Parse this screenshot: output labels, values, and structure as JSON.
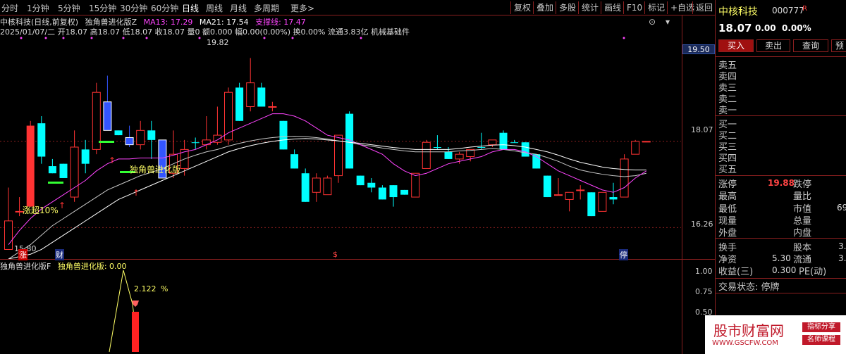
{
  "top_tabs": [
    "分时",
    "1分钟",
    "5分钟",
    "15分钟",
    "30分钟",
    "60分钟",
    "日线",
    "周线",
    "月线",
    "多周期",
    "更多>"
  ],
  "top_buttons": [
    "复权",
    "叠加",
    "多股",
    "统计",
    "画线",
    "F10",
    "标记",
    "+自选",
    "返回"
  ],
  "info_line1": {
    "title": "中核科技(日线,前复权)",
    "indicator": "独角兽进化版Z",
    "ma13": "MA13: 17.29",
    "ma21": "MA21: 17.54",
    "line": "支撑线: 17.47"
  },
  "info_line2": "2025/01/07/二 开18.07 高18.07 低18.07 收18.07 量0 额0.000 幅0.00(0.00%) 换0.00% 流通3.83亿 机械基础件",
  "price_axis": [
    "19.50",
    "18.07",
    "16.26"
  ],
  "annotations": {
    "high": "19.82",
    "low": "15.80",
    "zhangchao": "涨超10%",
    "unicorn": "独角兽进化版"
  },
  "markers": [
    "涨",
    "财",
    "$",
    "停"
  ],
  "sub_info": {
    "title": "独角兽进化版F",
    "value": "独角兽进化版: 0.00",
    "pct": "2.122",
    "pct_unit": "%"
  },
  "sub_axis": [
    "1.00",
    "0.75",
    "0.50"
  ],
  "panel": {
    "name": "中核科技",
    "code": "000777",
    "r": "R",
    "price": "18.07",
    "chg": "0.00",
    "pct": "0.00%",
    "buy": "买入",
    "sell": "卖出",
    "query": "查询",
    "pre": "预",
    "asks": [
      "卖五",
      "卖四",
      "卖三",
      "卖二",
      "卖一"
    ],
    "bids": [
      "买一",
      "买二",
      "买三",
      "买四",
      "买五"
    ],
    "limit_up_label": "涨停",
    "limit_up": "19.88",
    "limit_down_label": "跌停",
    "rows_left": [
      "最高",
      "最低",
      "现量",
      "外盘"
    ],
    "rows_right": [
      "量比",
      "市值",
      "总量",
      "内盘"
    ],
    "mktcap_partial": "69",
    "turnover_label": "换手",
    "equity_label": "股本",
    "equity_val": "3.",
    "nav_label": "净资",
    "nav": "5.30",
    "float_label": "流通",
    "float_val": "3.",
    "eps_label": "收益(三)",
    "eps": "0.300",
    "pe_label": "PE(动)",
    "status": "交易状态: 停牌"
  },
  "watermark": {
    "title": "股市财富网",
    "url": "WWW.GSCFW.COM",
    "tag1": "指标分享",
    "tag2": "名师课程"
  },
  "colors": {
    "up": "#ff3333",
    "down": "#00ffff",
    "bg": "#000000",
    "grid": "#8a1f1f",
    "ma13": "#ff44ff",
    "ma21": "#ffffff",
    "support": "#ff44ff"
  },
  "chart_data": {
    "type": "candlestick",
    "ylim": [
      15.6,
      20.3
    ],
    "candles": [
      {
        "o": 15.8,
        "h": 17.1,
        "l": 15.8,
        "c": 16.4,
        "up": true
      },
      {
        "o": 16.6,
        "h": 16.9,
        "l": 16.5,
        "c": 16.6,
        "up": true
      },
      {
        "o": 16.7,
        "h": 18.5,
        "l": 16.7,
        "c": 18.4,
        "up": true,
        "solid": true
      },
      {
        "o": 18.45,
        "h": 18.6,
        "l": 17.6,
        "c": 17.75,
        "up": false
      },
      {
        "o": 17.55,
        "h": 17.7,
        "l": 17.4,
        "c": 17.4,
        "up": false
      },
      {
        "o": 17.3,
        "h": 17.6,
        "l": 17.3,
        "c": 17.6,
        "up": false
      },
      {
        "o": 16.9,
        "h": 18.3,
        "l": 16.8,
        "c": 17.95,
        "up": true
      },
      {
        "o": 17.9,
        "h": 18.1,
        "l": 17.4,
        "c": 17.6,
        "up": false
      },
      {
        "o": 17.9,
        "h": 19.3,
        "l": 17.8,
        "c": 19.1,
        "up": true
      },
      {
        "o": 18.9,
        "h": 19.45,
        "l": 18.3,
        "c": 18.3,
        "up": false,
        "blue": true
      },
      {
        "o": 18.3,
        "h": 18.3,
        "l": 18.2,
        "c": 18.2,
        "up": false
      },
      {
        "o": 18.15,
        "h": 18.4,
        "l": 17.95,
        "c": 18.0,
        "up": false,
        "blue": true
      },
      {
        "o": 18.0,
        "h": 18.5,
        "l": 17.9,
        "c": 18.3,
        "up": true
      },
      {
        "o": 18.3,
        "h": 18.5,
        "l": 17.7,
        "c": 18.1,
        "up": false
      },
      {
        "o": 18.1,
        "h": 18.1,
        "l": 17.3,
        "c": 17.3,
        "up": false,
        "blue": true
      },
      {
        "o": 17.4,
        "h": 18.3,
        "l": 17.3,
        "c": 17.8,
        "up": true
      },
      {
        "o": 17.5,
        "h": 18.1,
        "l": 17.35,
        "c": 17.9,
        "up": true
      },
      {
        "o": 18.05,
        "h": 18.15,
        "l": 17.9,
        "c": 18.05,
        "up": false
      },
      {
        "o": 18.0,
        "h": 18.6,
        "l": 17.9,
        "c": 18.1,
        "up": true
      },
      {
        "o": 18.2,
        "h": 18.8,
        "l": 18.0,
        "c": 18.05,
        "up": true
      },
      {
        "o": 18.1,
        "h": 19.2,
        "l": 18.0,
        "c": 19.1,
        "up": true
      },
      {
        "o": 19.2,
        "h": 19.3,
        "l": 18.5,
        "c": 18.5,
        "up": false
      },
      {
        "o": 18.8,
        "h": 19.82,
        "l": 18.7,
        "c": 19.3,
        "up": true
      },
      {
        "o": 19.2,
        "h": 19.3,
        "l": 18.8,
        "c": 18.8,
        "up": false
      },
      {
        "o": 18.8,
        "h": 18.9,
        "l": 18.7,
        "c": 18.8,
        "up": true
      },
      {
        "o": 18.5,
        "h": 18.5,
        "l": 17.9,
        "c": 17.9,
        "up": false
      },
      {
        "o": 17.8,
        "h": 17.9,
        "l": 17.5,
        "c": 17.5,
        "up": false
      },
      {
        "o": 17.4,
        "h": 17.5,
        "l": 16.8,
        "c": 16.8,
        "up": false
      },
      {
        "o": 17.0,
        "h": 17.4,
        "l": 16.8,
        "c": 17.3,
        "up": true
      },
      {
        "o": 17.3,
        "h": 17.35,
        "l": 16.95,
        "c": 16.95,
        "up": true
      },
      {
        "o": 17.35,
        "h": 18.2,
        "l": 17.2,
        "c": 18.2,
        "up": true
      },
      {
        "o": 18.65,
        "h": 18.7,
        "l": 17.5,
        "c": 17.5,
        "up": false
      },
      {
        "o": 17.35,
        "h": 17.35,
        "l": 17.15,
        "c": 17.15,
        "up": false
      },
      {
        "o": 17.2,
        "h": 17.3,
        "l": 17.0,
        "c": 17.1,
        "up": false
      },
      {
        "o": 17.1,
        "h": 17.15,
        "l": 16.85,
        "c": 16.85,
        "up": false
      },
      {
        "o": 17.15,
        "h": 17.15,
        "l": 16.7,
        "c": 16.9,
        "up": false
      },
      {
        "o": 17.05,
        "h": 17.05,
        "l": 16.95,
        "c": 16.95,
        "up": false
      },
      {
        "o": 16.9,
        "h": 17.4,
        "l": 16.9,
        "c": 17.4,
        "up": true
      },
      {
        "o": 17.5,
        "h": 18.1,
        "l": 17.5,
        "c": 18.05,
        "up": true
      },
      {
        "o": 17.95,
        "h": 18.2,
        "l": 17.9,
        "c": 17.95,
        "up": false
      },
      {
        "o": 17.85,
        "h": 17.95,
        "l": 17.7,
        "c": 17.7,
        "up": false
      },
      {
        "o": 17.7,
        "h": 17.85,
        "l": 17.6,
        "c": 17.8,
        "up": true
      },
      {
        "o": 17.75,
        "h": 17.9,
        "l": 17.65,
        "c": 17.9,
        "up": true
      },
      {
        "o": 17.95,
        "h": 18.25,
        "l": 17.9,
        "c": 17.95,
        "up": false
      },
      {
        "o": 18.1,
        "h": 18.1,
        "l": 17.95,
        "c": 18.0,
        "up": true
      },
      {
        "o": 18.25,
        "h": 18.3,
        "l": 17.9,
        "c": 17.9,
        "up": false
      },
      {
        "o": 18.05,
        "h": 18.1,
        "l": 18.05,
        "c": 18.05,
        "up": false
      },
      {
        "o": 18.05,
        "h": 18.05,
        "l": 17.75,
        "c": 17.75,
        "up": false
      },
      {
        "o": 17.8,
        "h": 17.8,
        "l": 17.5,
        "c": 17.5,
        "up": false
      },
      {
        "o": 17.35,
        "h": 17.35,
        "l": 16.9,
        "c": 16.9,
        "up": false
      },
      {
        "o": 16.95,
        "h": 17.3,
        "l": 16.95,
        "c": 16.95,
        "up": true
      },
      {
        "o": 16.85,
        "h": 17.0,
        "l": 16.6,
        "c": 17.0,
        "up": true
      },
      {
        "o": 17.05,
        "h": 17.15,
        "l": 16.85,
        "c": 17.05,
        "up": true
      },
      {
        "o": 17.0,
        "h": 17.0,
        "l": 16.5,
        "c": 16.5,
        "up": false
      },
      {
        "o": 16.6,
        "h": 17.0,
        "l": 16.6,
        "c": 17.0,
        "up": true
      },
      {
        "o": 16.85,
        "h": 17.2,
        "l": 16.75,
        "c": 16.9,
        "up": false
      },
      {
        "o": 16.9,
        "h": 17.8,
        "l": 16.9,
        "c": 17.7,
        "up": true
      },
      {
        "o": 17.8,
        "h": 18.1,
        "l": 17.8,
        "c": 18.07,
        "up": true
      },
      {
        "o": 18.07,
        "h": 18.07,
        "l": 18.07,
        "c": 18.07,
        "up": true
      }
    ],
    "ma13": [
      15.9,
      16.2,
      16.45,
      16.65,
      16.8,
      16.95,
      17.1,
      17.25,
      17.45,
      17.6,
      17.7,
      17.7,
      17.72,
      17.72,
      17.72,
      17.78,
      17.85,
      17.9,
      18.0,
      18.1,
      18.25,
      18.35,
      18.45,
      18.55,
      18.65,
      18.65,
      18.6,
      18.5,
      18.35,
      18.2,
      18.15,
      18.1,
      18.0,
      17.9,
      17.8,
      17.6,
      17.45,
      17.35,
      17.4,
      17.5,
      17.6,
      17.65,
      17.7,
      17.75,
      17.85,
      17.9,
      17.9,
      17.85,
      17.75,
      17.6,
      17.45,
      17.35,
      17.25,
      17.15,
      17.05,
      17.0,
      17.1,
      17.3,
      17.45
    ],
    "ma21": [
      15.6,
      15.75,
      15.9,
      16.1,
      16.3,
      16.45,
      16.6,
      16.75,
      16.9,
      17.05,
      17.15,
      17.25,
      17.35,
      17.42,
      17.5,
      17.6,
      17.7,
      17.78,
      17.85,
      17.9,
      17.97,
      18.03,
      18.08,
      18.12,
      18.15,
      18.17,
      18.18,
      18.17,
      18.15,
      18.12,
      18.08,
      18.05,
      18.0,
      17.97,
      17.93,
      17.9,
      17.87,
      17.85,
      17.85,
      17.85,
      17.85,
      17.87,
      17.88,
      17.9,
      17.92,
      17.9,
      17.87,
      17.83,
      17.8,
      17.73,
      17.65,
      17.55,
      17.47,
      17.42,
      17.38,
      17.35,
      17.33,
      17.35,
      17.4
    ],
    "support": [
      15.6,
      15.65,
      15.7,
      15.8,
      15.95,
      16.1,
      16.25,
      16.4,
      16.55,
      16.7,
      16.85,
      16.95,
      17.05,
      17.15,
      17.25,
      17.35,
      17.45,
      17.55,
      17.65,
      17.75,
      17.85,
      17.92,
      17.98,
      18.03,
      18.07,
      18.1,
      18.12,
      18.13,
      18.12,
      18.1,
      18.08,
      18.05,
      18.03,
      18.0,
      17.97,
      17.94,
      17.92,
      17.9,
      17.9,
      17.9,
      17.9,
      17.92,
      17.95,
      17.97,
      17.99,
      18.0,
      17.98,
      17.95,
      17.9,
      17.85,
      17.78,
      17.7,
      17.63,
      17.58,
      17.53,
      17.5,
      17.48,
      17.47,
      17.47
    ]
  }
}
